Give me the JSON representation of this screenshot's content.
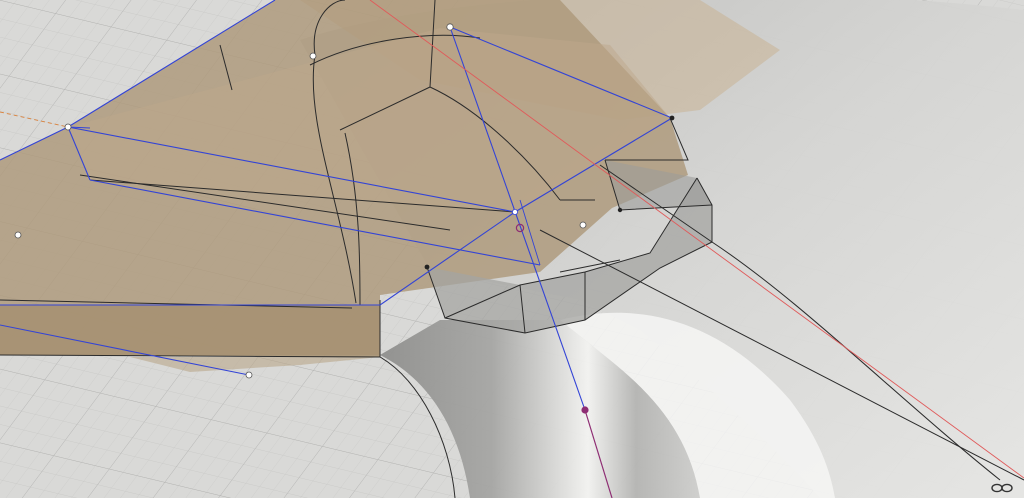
{
  "app": {
    "kind": "cad-viewport"
  },
  "colors": {
    "background": "#d9d9d7",
    "grid_minor": "#c7c7c5",
    "grid_major": "#b5b5b3",
    "tan_surface": "#b09a7b",
    "tan_light": "#c6b398",
    "blue_edge": "#3848d8",
    "dark_edge": "#2c2c2c",
    "red_axis": "#e05a5a",
    "purple_axis": "#8e2d73",
    "orange_dash": "#d9813c",
    "gray_body": "#a9a9a7",
    "gray_light": "#e9e9e7"
  },
  "icons": {
    "nav": "link-infinity-icon"
  }
}
